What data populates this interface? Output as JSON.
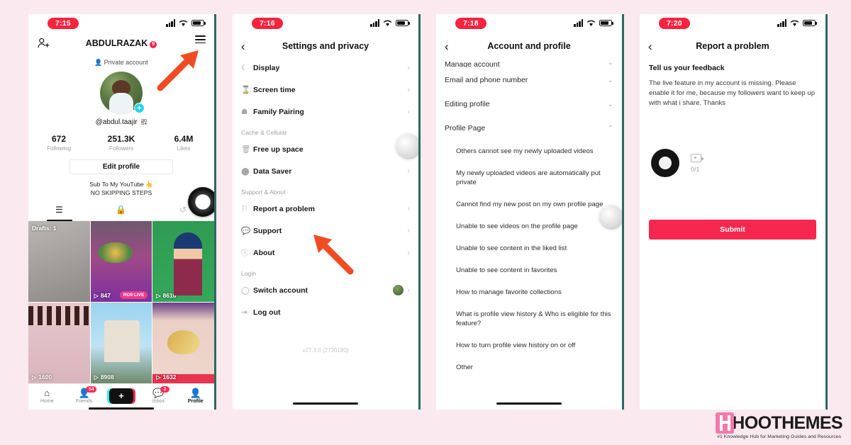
{
  "background_color": "#fae9ef",
  "accent_color": "#fe2c55",
  "panels": [
    {
      "id": "profile",
      "status": {
        "time": "7:15"
      },
      "header": {
        "username": "ABDULRAZAK",
        "badge": "9",
        "add_friend_icon": "add-friend-icon",
        "menu_icon": "hamburger-icon"
      },
      "private_label": "Private account",
      "handle": "@abdul.taajir",
      "stats": [
        {
          "value": "672",
          "label": "Following"
        },
        {
          "value": "251.3K",
          "label": "Followers"
        },
        {
          "value": "6.4M",
          "label": "Likes"
        }
      ],
      "edit_profile": "Edit profile",
      "bio_line1": "Sub To My YouTube 👆",
      "bio_line2": "NO SKIPPING STEPS",
      "tabs": [
        {
          "name": "grid-tab",
          "glyph": "⦀"
        },
        {
          "name": "private-tab",
          "glyph": "🔒"
        },
        {
          "name": "reposts-tab",
          "glyph": "↻"
        }
      ],
      "grid": [
        {
          "drafts": "Drafts: 1",
          "views": ""
        },
        {
          "views": "847",
          "live": "RO9 LIVE"
        },
        {
          "views": "8616"
        },
        {
          "views": "1600"
        },
        {
          "views": "8908"
        },
        {
          "views": "1632"
        }
      ],
      "bottom_nav": [
        {
          "label": "Home",
          "icon": "home-icon",
          "badge": ""
        },
        {
          "label": "Friends",
          "icon": "friends-icon",
          "badge": "54"
        },
        {
          "label": "",
          "icon": "create-plus-icon",
          "badge": ""
        },
        {
          "label": "Inbox",
          "icon": "inbox-icon",
          "badge": "2"
        },
        {
          "label": "Profile",
          "icon": "profile-icon",
          "badge": ""
        }
      ]
    },
    {
      "id": "settings",
      "status": {
        "time": "7:16"
      },
      "title": "Settings and privacy",
      "back_icon": "chevron-left-icon",
      "rows": [
        {
          "label": "Display",
          "icon": "moon-icon"
        },
        {
          "label": "Screen time",
          "icon": "hourglass-icon"
        },
        {
          "label": "Family Pairing",
          "icon": "shield-icon"
        }
      ],
      "group_cache": "Cache & Cellular",
      "rows_cache": [
        {
          "label": "Free up space",
          "icon": "trash-icon"
        },
        {
          "label": "Data Saver",
          "icon": "droplet-icon"
        }
      ],
      "group_support": "Support & About",
      "rows_support": [
        {
          "label": "Report a problem",
          "icon": "flag-icon"
        },
        {
          "label": "Support",
          "icon": "chat-icon"
        },
        {
          "label": "About",
          "icon": "info-icon"
        }
      ],
      "group_login": "Login",
      "rows_login": [
        {
          "label": "Switch account",
          "icon": "switch-icon"
        },
        {
          "label": "Log out",
          "icon": "logout-icon"
        }
      ],
      "version": "v27.3.0 (2730180)"
    },
    {
      "id": "account",
      "status": {
        "time": "7:18"
      },
      "title": "Account and profile",
      "back_icon": "chevron-left-icon",
      "sections": [
        {
          "label": "Manage account",
          "expanded": false,
          "clipped": true
        },
        {
          "label": "Email and phone number",
          "expanded": false
        },
        {
          "label": "Editing profile",
          "expanded": false
        },
        {
          "label": "Profile Page",
          "expanded": true
        }
      ],
      "profile_page_items": [
        "Others cannot see my newly uploaded videos",
        "My newly uploaded videos are automatically put private",
        "Cannot find my new post on my own profile page",
        "Unable to see videos on the profile page",
        "Unable to see content in the liked list",
        "Unable to see content in favorites",
        "How to manage favorite collections",
        "What is profile view history & Who is eligible for this feature?",
        "How to turn profile view history on or off",
        "Other"
      ]
    },
    {
      "id": "report",
      "status": {
        "time": "7:20"
      },
      "title": "Report a problem",
      "back_icon": "chevron-left-icon",
      "feedback_title": "Tell us your feedback",
      "feedback_text": "The live feature in my account is missing. Please enable it for me, because my followers want to keep up with what i share. Thanks",
      "attachment_count": "0/1",
      "camera_icon": "camera-record-icon",
      "add_media_icon": "add-video-icon",
      "submit_label": "Submit"
    }
  ],
  "logo": {
    "name": "HOOTHEMES",
    "tagline": "#1 Knowledge Hub for Marketing Guides and Resources"
  }
}
